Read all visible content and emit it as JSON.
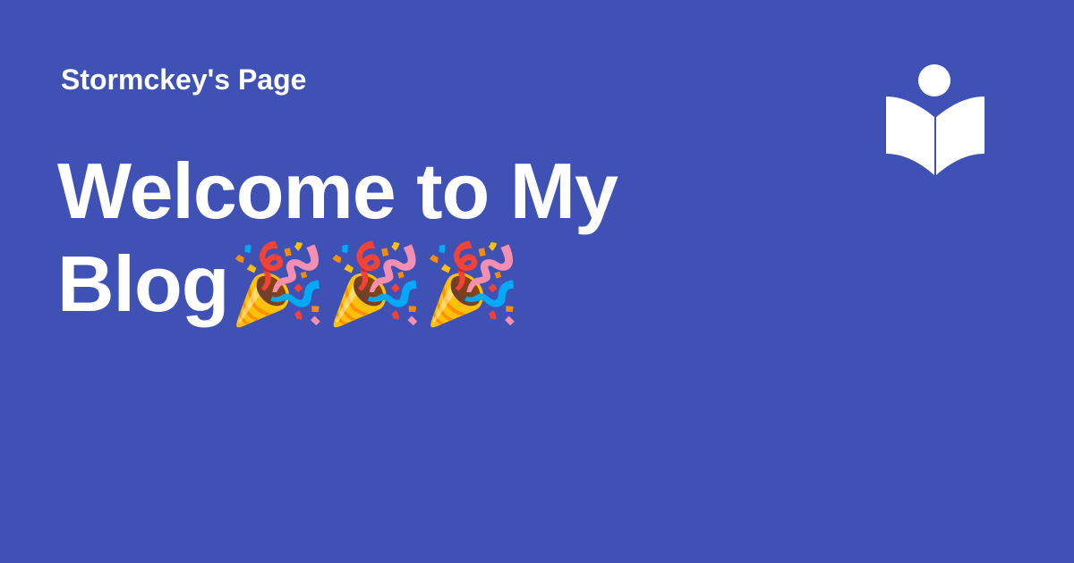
{
  "site": {
    "name": "Stormckey's Page"
  },
  "headline": {
    "text": "Welcome to My Blog🎉🎉🎉"
  },
  "logo": {
    "icon": "open-book-reader-icon",
    "color": "#ffffff"
  },
  "theme": {
    "background": "#3f51b5",
    "text": "#ffffff"
  }
}
